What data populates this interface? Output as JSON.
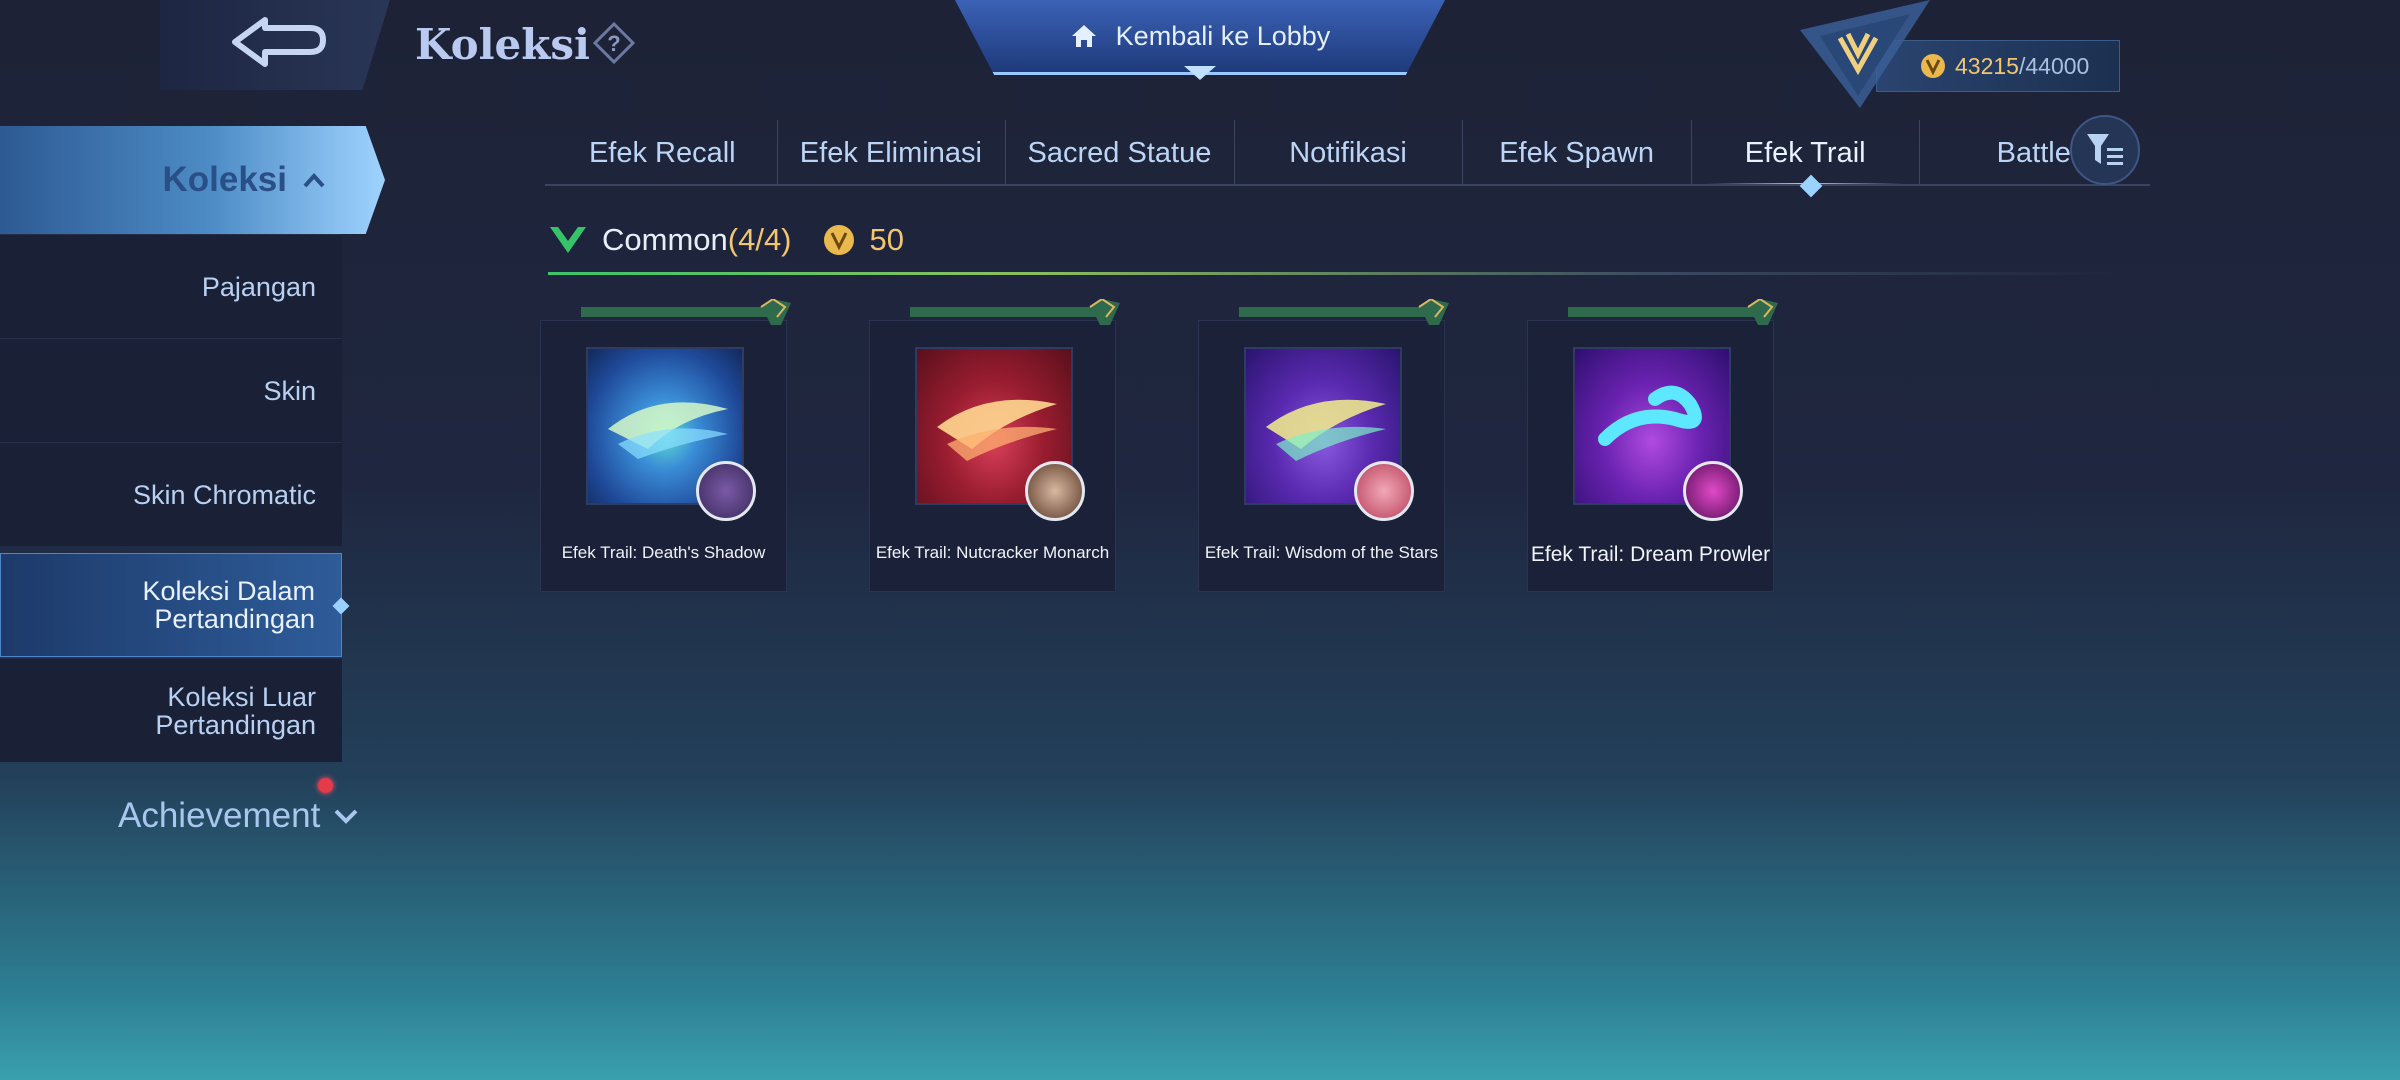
{
  "header": {
    "title": "Koleksi",
    "lobby_label": "Kembali ke Lobby",
    "currency": {
      "current": "43215",
      "max": "/44000"
    }
  },
  "sidebar": {
    "main": "Koleksi",
    "items": [
      {
        "label": "Pajangan"
      },
      {
        "label": "Skin"
      },
      {
        "label": "Skin Chromatic"
      },
      {
        "label": "Koleksi Dalam Pertandingan",
        "active": true
      },
      {
        "label": "Koleksi Luar Pertandingan"
      }
    ],
    "achievement": "Achievement"
  },
  "tabs": [
    "Efek Recall",
    "Efek Eliminasi",
    "Sacred Statue",
    "Notifikasi",
    "Efek Spawn",
    "Efek Trail",
    "Battle"
  ],
  "active_tab": "Efek Trail",
  "section": {
    "label": "Common",
    "count": "(4/4)",
    "points": "50"
  },
  "cards": [
    {
      "label": "Efek Trail: Death's Shadow",
      "theme": "#1f5aa6"
    },
    {
      "label": "Efek Trail: Nutcracker Monarch",
      "theme": "#8e1d2c"
    },
    {
      "label": "Efek Trail: Wisdom of the Stars",
      "theme": "#4a2aa0"
    },
    {
      "label": "Efek Trail: Dream Prowler",
      "theme": "#5a22a6"
    }
  ],
  "colors": {
    "accent_blue": "#9cd2ff",
    "gold": "#f2c670",
    "badge_red": "#e43a4a"
  }
}
